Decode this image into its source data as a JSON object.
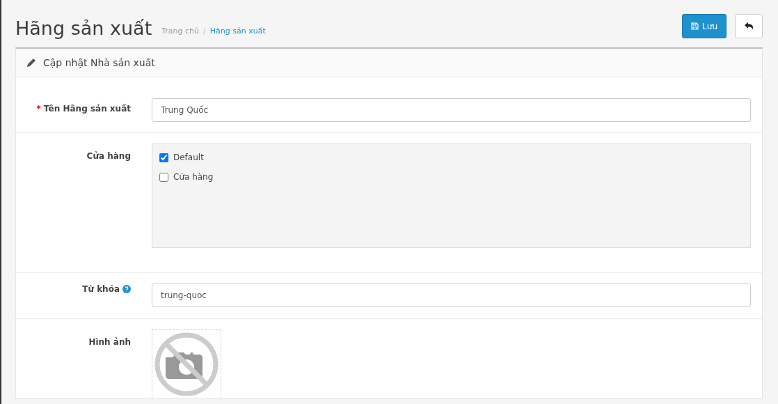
{
  "page": {
    "title": "Hãng sản xuất"
  },
  "breadcrumb_separator": "/",
  "breadcrumb": [
    {
      "label": "Trang chủ",
      "selected": false
    },
    {
      "label": "Hãng sản xuất",
      "selected": true
    }
  ],
  "toolbar": {
    "save_label": "Lưu"
  },
  "card": {
    "title": "Cập nhật Nhà sản xuất"
  },
  "fields": [
    {
      "kind": "text",
      "label": "Tên Hãng sản xuất",
      "required_mark": "*",
      "value": "Trung Quốc"
    },
    {
      "kind": "checklist",
      "label": "Cửa hàng",
      "options": [
        {
          "label": "Default",
          "checked": true
        },
        {
          "label": "Cửa hàng",
          "checked": false
        }
      ]
    },
    {
      "kind": "text",
      "label": "Từ khóa",
      "help": true,
      "value": "trung-quoc"
    },
    {
      "kind": "image",
      "label": "Hình ảnh"
    }
  ]
}
